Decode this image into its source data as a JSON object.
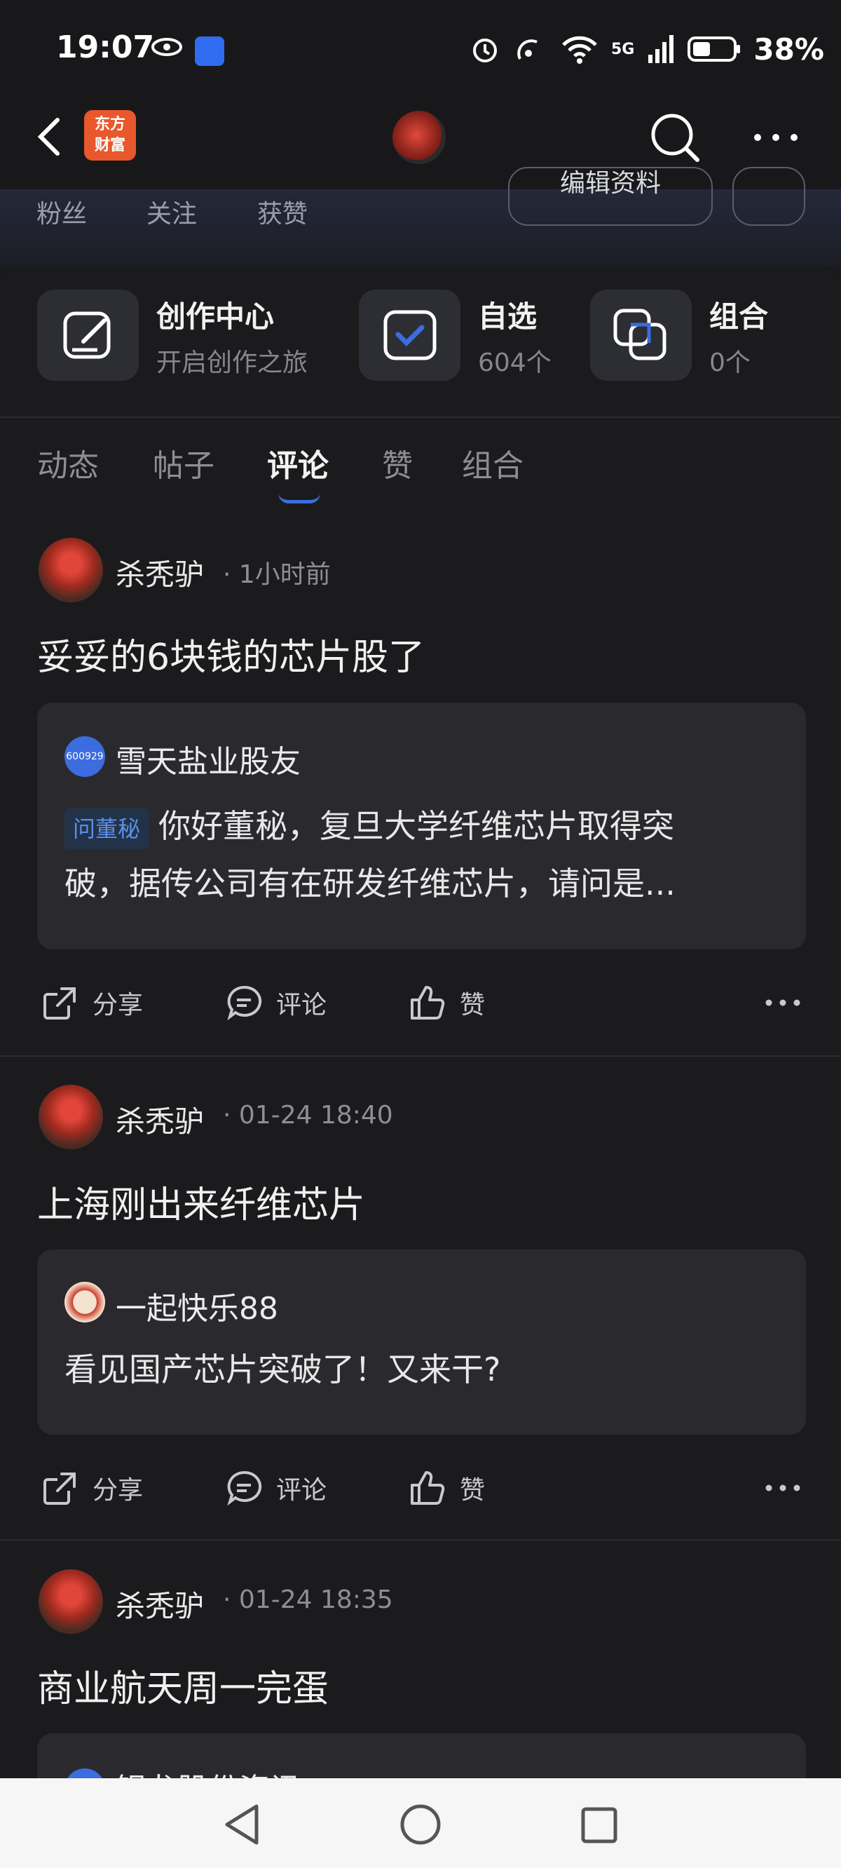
{
  "status_bar": {
    "time": "19:07",
    "network": "5G",
    "signal_count": "1",
    "battery": "38%"
  },
  "header": {
    "logo_text_1": "东方",
    "logo_text_2": "财富"
  },
  "stats": {
    "fans": "粉丝",
    "follow": "关注",
    "likes": "获赞",
    "edit": "编辑资料"
  },
  "tiles": [
    {
      "title": "创作中心",
      "sub": "开启创作之旅",
      "icon": "edit-icon"
    },
    {
      "title": "自选",
      "sub": "604个",
      "icon": "checkbox-icon"
    },
    {
      "title": "组合",
      "sub": "0个",
      "icon": "stack-icon"
    }
  ],
  "tabs": [
    "动态",
    "帖子",
    "评论",
    "赞",
    "组合"
  ],
  "active_tab": "评论",
  "actions": {
    "share": "分享",
    "comment": "评论",
    "like": "赞"
  },
  "posts": [
    {
      "author": "杀秃驴",
      "time": "1小时前",
      "text": "妥妥的6块钱的芯片股了",
      "quote": {
        "badge_text": "600929",
        "name": "雪天盐业股友",
        "tag": "问董秘",
        "line1": "你好董秘，复旦大学纤维芯片取得突",
        "line2": "破，据传公司有在研发纤维芯片，请问是..."
      }
    },
    {
      "author": "杀秃驴",
      "time": "01-24 18:40",
      "text": "上海刚出来纤维芯片",
      "quote": {
        "name": "一起快乐88",
        "line1": "看见国产芯片突破了！又来干?"
      }
    },
    {
      "author": "杀秃驴",
      "time": "01-24 18:35",
      "text": "商业航天周一完蛋",
      "quote": {
        "name": "银龙股份资讯"
      }
    }
  ],
  "colors": {
    "accent": "#3b6de0",
    "background": "#1b1b1d",
    "card": "#2a2a2e",
    "logo": "#e8582c"
  }
}
